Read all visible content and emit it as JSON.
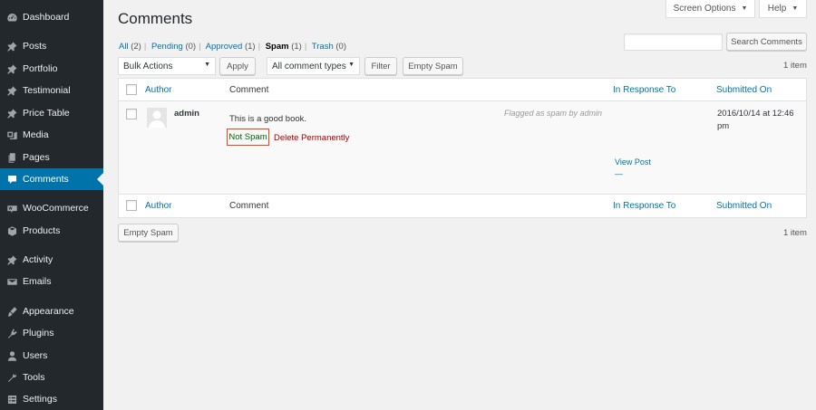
{
  "sidebar": {
    "items": [
      {
        "label": "Dashboard",
        "icon": "dashboard-icon"
      },
      {
        "label": "Posts",
        "icon": "pin-icon"
      },
      {
        "label": "Portfolio",
        "icon": "pin-icon"
      },
      {
        "label": "Testimonial",
        "icon": "pin-icon"
      },
      {
        "label": "Price Table",
        "icon": "pin-icon"
      },
      {
        "label": "Media",
        "icon": "media-icon"
      },
      {
        "label": "Pages",
        "icon": "page-icon"
      },
      {
        "label": "Comments",
        "icon": "comment-icon",
        "active": true
      },
      {
        "label": "WooCommerce",
        "icon": "woocommerce-icon"
      },
      {
        "label": "Products",
        "icon": "products-icon"
      },
      {
        "label": "Activity",
        "icon": "activity-icon"
      },
      {
        "label": "Emails",
        "icon": "email-icon"
      },
      {
        "label": "Appearance",
        "icon": "appearance-icon"
      },
      {
        "label": "Plugins",
        "icon": "plugin-icon"
      },
      {
        "label": "Users",
        "icon": "users-icon"
      },
      {
        "label": "Tools",
        "icon": "tools-icon"
      },
      {
        "label": "Settings",
        "icon": "settings-icon"
      }
    ]
  },
  "header": {
    "title": "Comments",
    "screen_options": "Screen Options",
    "help": "Help"
  },
  "filters": {
    "all": "All",
    "all_count": "(2)",
    "pending": "Pending",
    "pending_count": "(0)",
    "approved": "Approved",
    "approved_count": "(1)",
    "spam": "Spam",
    "spam_count": "(1)",
    "trash": "Trash",
    "trash_count": "(0)",
    "separator": "|"
  },
  "search": {
    "value": "",
    "button": "Search Comments"
  },
  "toolbar": {
    "bulk_actions": "Bulk Actions",
    "apply": "Apply",
    "comment_types": "All comment types",
    "filter": "Filter",
    "empty_spam": "Empty Spam",
    "items_count": "1 item"
  },
  "table": {
    "columns": {
      "author": "Author",
      "comment": "Comment",
      "in_response_to": "In Response To",
      "submitted_on": "Submitted On"
    },
    "rows": [
      {
        "author": "admin",
        "comment": "This is a good book.",
        "flag": "Flagged as spam by admin",
        "actions": {
          "not_spam": "Not Spam",
          "delete": "Delete Permanently"
        },
        "response": {
          "view_post": "View Post",
          "dash": "—"
        },
        "date_line1": "2016/10/14 at 12:46",
        "date_line2": "pm"
      }
    ]
  },
  "bottom": {
    "empty_spam": "Empty Spam",
    "items_count": "1 item"
  },
  "colors": {
    "sidebar_bg": "#23282d",
    "active_item": "#0073aa",
    "link": "#0073aa",
    "not_spam": "#006505",
    "delete": "#a00000",
    "highlight_border": "#d54e21"
  }
}
